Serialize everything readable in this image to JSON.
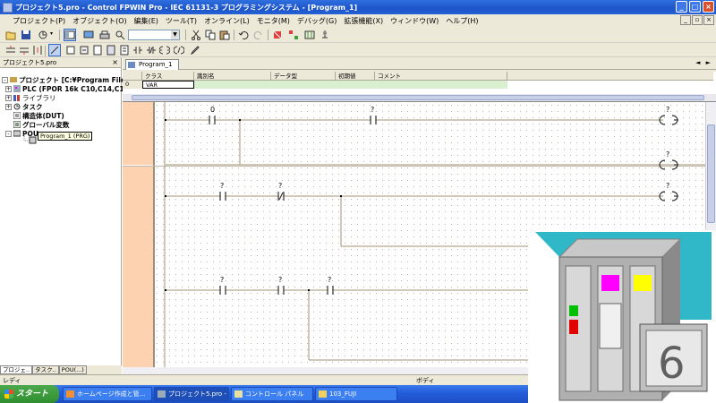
{
  "window": {
    "title": "プロジェクト5.pro - Control FPWIN Pro - IEC 61131-3 プログラミングシステム - [Program_1]"
  },
  "menu": [
    "プロジェクト(P)",
    "オブジェクト(O)",
    "編集(E)",
    "ツール(T)",
    "オンライン(L)",
    "モニタ(M)",
    "デバッグ(G)",
    "拡張機能(X)",
    "ウィンドウ(W)",
    "ヘルプ(H)"
  ],
  "project_pane": {
    "title": "プロジェクト5.pro",
    "close_label": "×",
    "tree": [
      {
        "label": "プロジェクト [C:¥Program Files¥Pa",
        "icon": "project-icon",
        "expand": "-"
      },
      {
        "label": "PLC (FPOR 16k C10,C14,C1",
        "icon": "plc-icon",
        "expand": "+"
      },
      {
        "label": "ライブラリ",
        "icon": "library-icon",
        "expand": "+"
      },
      {
        "label": "タスク",
        "icon": "task-icon",
        "expand": "+"
      },
      {
        "label": "構造体(DUT)",
        "icon": "dut-icon",
        "expand": ""
      },
      {
        "label": "グローバル変数",
        "icon": "global-vars-icon",
        "expand": ""
      },
      {
        "label": "POU",
        "icon": "pou-icon",
        "expand": "-"
      }
    ],
    "tooltip": "Program_1 (PRG)",
    "tabs": [
      "プロジェ..",
      "タスク..",
      "POU(...)"
    ]
  },
  "editor": {
    "tab_label": "Program_1",
    "nav_arrows": "◄ ►",
    "var_table": {
      "headers": [
        "クラス",
        "識別名",
        "データ型",
        "初期値",
        "コメント"
      ],
      "rows": [
        {
          "index": "0",
          "class": "VAR",
          "identifier": "",
          "type": "",
          "initial": "",
          "comment": ""
        }
      ]
    },
    "ladder": {
      "contact_labels": [
        "0",
        "?",
        "?",
        "?",
        "?",
        "?",
        "?"
      ],
      "coil_label": "?"
    }
  },
  "statusbar": {
    "left": "レディ",
    "mode": "ボディ"
  },
  "taskbar": {
    "start_label": "スタート",
    "tasks": [
      "ホームページ作成と管...",
      "プロジェクト5.pro - Con...",
      "コントロール パネル",
      "103_FUJI"
    ]
  },
  "logo": {
    "badge_text": "6",
    "colors": {
      "teal": "#30b8c8",
      "magenta": "#ff00ff",
      "yellow": "#ffff00",
      "green": "#00c000",
      "red": "#e00000"
    }
  }
}
